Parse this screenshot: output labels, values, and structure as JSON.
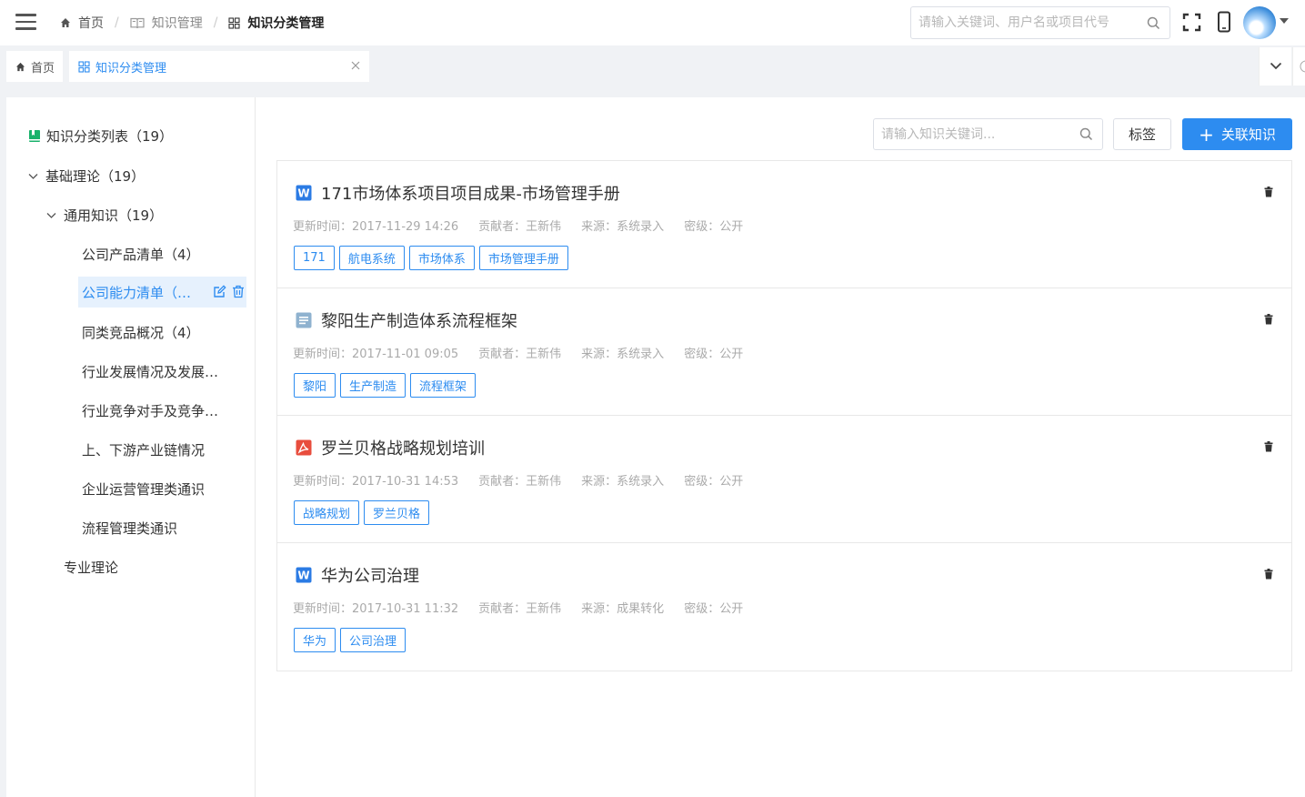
{
  "header": {
    "breadcrumb": [
      {
        "label": "首页",
        "icon": "home-icon"
      },
      {
        "label": "知识管理",
        "icon": "book-icon"
      },
      {
        "label": "知识分类管理",
        "icon": "grid-icon"
      }
    ],
    "search_placeholder": "请输入关键词、用户名或项目代号"
  },
  "tabs": {
    "home_label": "首页",
    "active_label": "知识分类管理"
  },
  "tree": {
    "root_label": "知识分类列表（19）",
    "level1": [
      {
        "label": "基础理论（19）"
      },
      {
        "label": "专业理论"
      }
    ],
    "level2": [
      {
        "label": "通用知识（19）"
      }
    ],
    "leaves": [
      {
        "label": "公司产品清单（4）"
      },
      {
        "label": "公司能力清单（…"
      },
      {
        "label": "同类竞品概况（4）"
      },
      {
        "label": "行业发展情况及发展…"
      },
      {
        "label": "行业竞争对手及竞争…"
      },
      {
        "label": "上、下游产业链情况"
      },
      {
        "label": "企业运营管理类通识"
      },
      {
        "label": "流程管理类通识"
      }
    ],
    "selected_index": 1
  },
  "toolbar": {
    "search_placeholder": "请输入知识关键词...",
    "tag_button": "标签",
    "link_button": "关联知识"
  },
  "items": [
    {
      "title": "171市场体系项目项目成果-市场管理手册",
      "file_type": "word",
      "updated": "更新时间：2017-11-29 14:26",
      "contributor": "贡献者：王新伟",
      "source": "来源：系统录入",
      "level": "密级：公开",
      "tags": [
        "171",
        "航电系统",
        "市场体系",
        "市场管理手册"
      ]
    },
    {
      "title": "黎阳生产制造体系流程框架",
      "file_type": "doc",
      "updated": "更新时间：2017-11-01 09:05",
      "contributor": "贡献者：王新伟",
      "source": "来源：系统录入",
      "level": "密级：公开",
      "tags": [
        "黎阳",
        "生产制造",
        "流程框架"
      ]
    },
    {
      "title": "罗兰贝格战略规划培训",
      "file_type": "pdf",
      "updated": "更新时间：2017-10-31 14:53",
      "contributor": "贡献者：王新伟",
      "source": "来源：系统录入",
      "level": "密级：公开",
      "tags": [
        "战略规划",
        "罗兰贝格"
      ]
    },
    {
      "title": "华为公司治理",
      "file_type": "word",
      "updated": "更新时间：2017-10-31 11:32",
      "contributor": "贡献者：王新伟",
      "source": "来源：成果转化",
      "level": "密级：公开",
      "tags": [
        "华为",
        "公司治理"
      ]
    }
  ],
  "colors": {
    "primary": "#2d8cf0",
    "word": "#2b7be4",
    "doc": "#8fb2cf",
    "pdf": "#e84d3d",
    "tree_root_icon": "#19b26b"
  }
}
